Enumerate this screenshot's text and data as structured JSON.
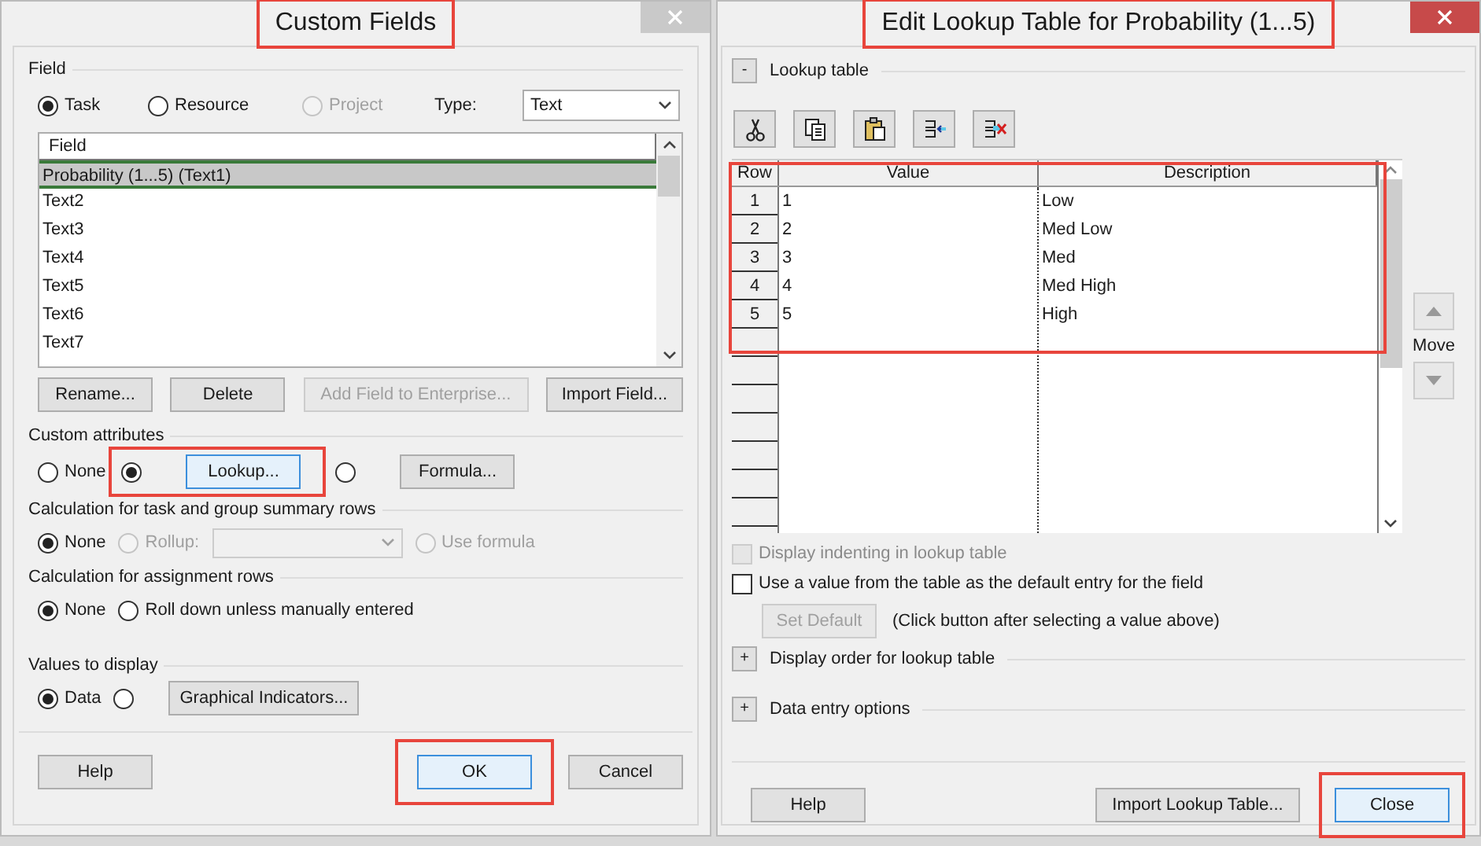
{
  "custom_fields": {
    "title": "Custom Fields",
    "title_highlighted": true,
    "field_group": {
      "label": "Field",
      "entity_options": [
        {
          "label": "Task",
          "selected": true,
          "disabled": false
        },
        {
          "label": "Resource",
          "selected": false,
          "disabled": false
        },
        {
          "label": "Project",
          "selected": false,
          "disabled": true
        }
      ],
      "type_label": "Type:",
      "type_value": "Text",
      "list_header": "Field",
      "items": [
        {
          "label": "Probability (1...5) (Text1)",
          "selected": true
        },
        {
          "label": "Text2",
          "selected": false
        },
        {
          "label": "Text3",
          "selected": false
        },
        {
          "label": "Text4",
          "selected": false
        },
        {
          "label": "Text5",
          "selected": false
        },
        {
          "label": "Text6",
          "selected": false
        },
        {
          "label": "Text7",
          "selected": false
        }
      ],
      "buttons": [
        {
          "label": "Rename...",
          "disabled": false
        },
        {
          "label": "Delete",
          "disabled": false
        },
        {
          "label": "Add Field to Enterprise...",
          "disabled": true
        },
        {
          "label": "Import Field...",
          "disabled": false
        }
      ]
    },
    "custom_attributes": {
      "label": "Custom attributes",
      "options": [
        {
          "kind": "label",
          "label": "None",
          "selected": false
        },
        {
          "kind": "button",
          "label": "Lookup...",
          "selected": true,
          "highlighted": true
        },
        {
          "kind": "button",
          "label": "Formula...",
          "selected": false
        }
      ]
    },
    "summary_calculation": {
      "label": "Calculation for task and group summary rows",
      "options": [
        {
          "kind": "label",
          "label": "None",
          "selected": true,
          "disabled": false
        },
        {
          "kind": "label",
          "label": "Rollup:",
          "selected": false,
          "disabled": true
        },
        {
          "kind": "dropdown",
          "disabled": true
        },
        {
          "kind": "label",
          "label": "Use formula",
          "selected": false,
          "disabled": true
        }
      ]
    },
    "assignment_calculation": {
      "label": "Calculation for assignment rows",
      "options": [
        {
          "kind": "label",
          "label": "None",
          "selected": true
        },
        {
          "kind": "label",
          "label": "Roll down unless manually entered",
          "selected": false
        }
      ]
    },
    "values_to_display": {
      "label": "Values to display",
      "options": [
        {
          "kind": "label",
          "label": "Data",
          "selected": true
        },
        {
          "kind": "button",
          "label": "Graphical Indicators...",
          "selected": false
        }
      ]
    },
    "footer_buttons": [
      {
        "label": "Help",
        "default": false
      },
      {
        "label": "OK",
        "default": true,
        "highlighted": true
      },
      {
        "label": "Cancel",
        "default": false
      }
    ]
  },
  "lookup_dialog": {
    "title": "Edit Lookup Table for Probability (1...5)",
    "title_highlighted": true,
    "lookup_section": {
      "toggle": "-",
      "label": "Lookup table"
    },
    "table": {
      "highlighted": true,
      "columns": [
        "Row",
        "Value",
        "Description"
      ],
      "rows": [
        [
          "1",
          "1",
          "Low"
        ],
        [
          "2",
          "2",
          "Med Low"
        ],
        [
          "3",
          "3",
          "Med"
        ],
        [
          "4",
          "4",
          "Med High"
        ],
        [
          "5",
          "5",
          "High"
        ]
      ]
    },
    "move_label": "Move",
    "checkboxes": [
      {
        "label": "Display indenting in lookup table",
        "checked": false,
        "disabled": true
      },
      {
        "label": "Use a value from the table as the default entry for the field",
        "checked": false,
        "disabled": false
      }
    ],
    "set_default": {
      "label": "Set Default",
      "disabled": true,
      "note": "(Click button after selecting a value above)"
    },
    "sections": [
      {
        "toggle": "+",
        "label": "Display order for lookup table"
      },
      {
        "toggle": "+",
        "label": "Data entry options"
      }
    ],
    "footer_buttons": [
      {
        "label": "Help",
        "default": false
      },
      {
        "label": "Import Lookup Table...",
        "default": false
      },
      {
        "label": "Close",
        "default": true,
        "highlighted": true
      }
    ]
  }
}
